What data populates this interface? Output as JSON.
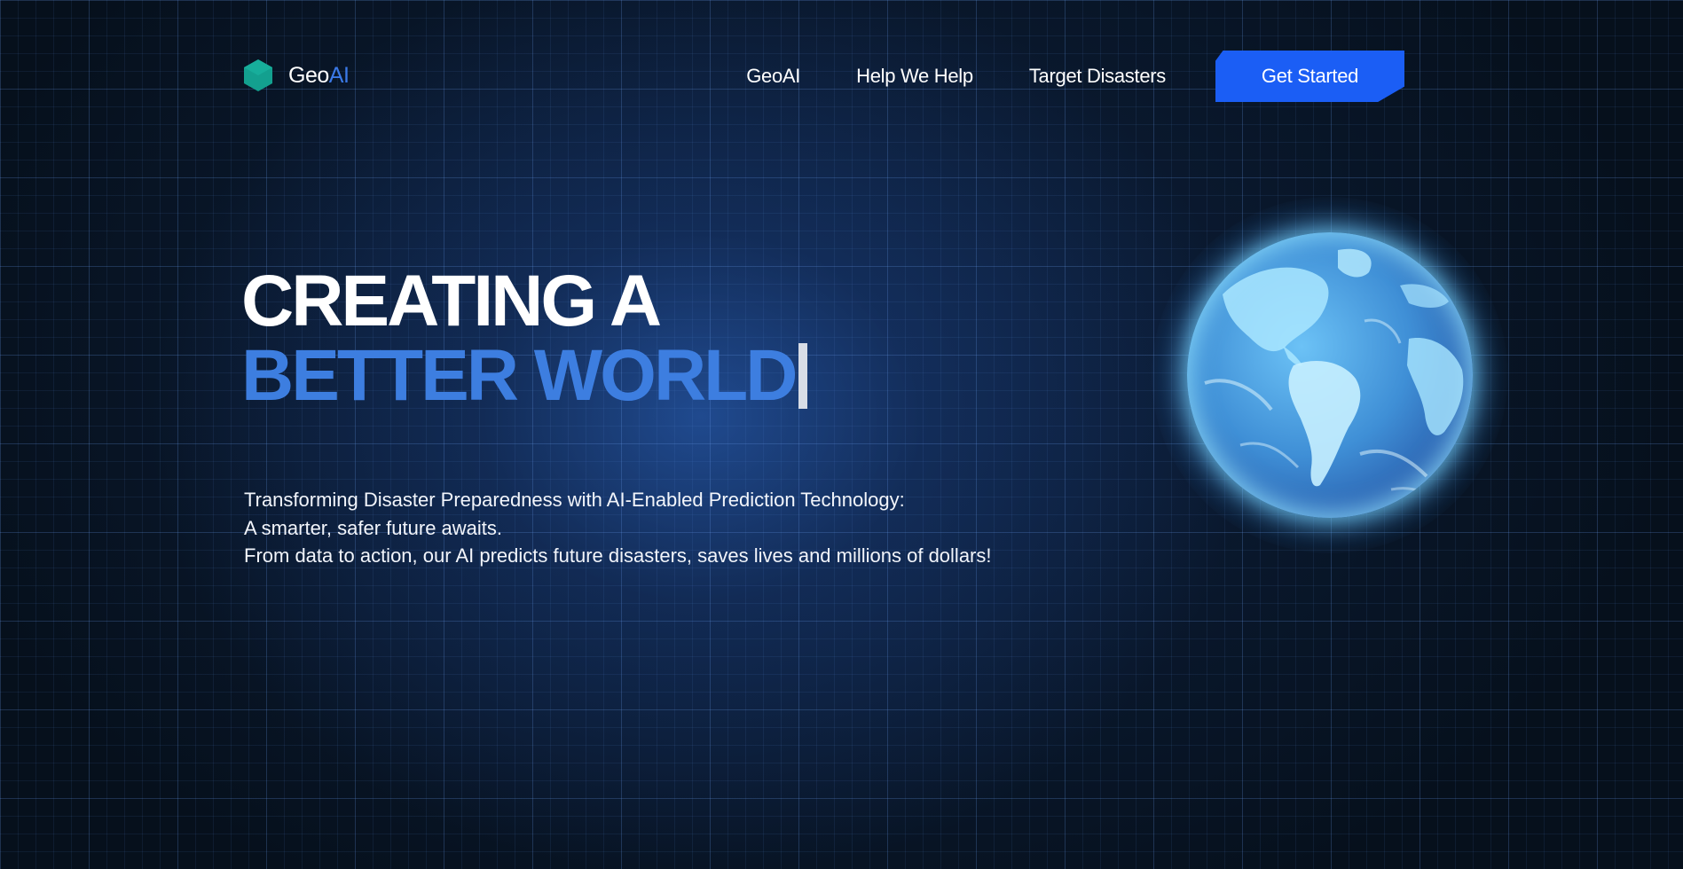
{
  "brand": {
    "name_prefix": "Geo",
    "name_accent": "AI",
    "icon": "hexagon-logo-icon",
    "icon_color": "#13a08f"
  },
  "nav": {
    "links": [
      {
        "label": "GeoAI"
      },
      {
        "label": "Help We Help"
      },
      {
        "label": "Target Disasters"
      }
    ],
    "cta_label": "Get Started",
    "cta_color": "#1b5ef5"
  },
  "hero": {
    "title_line1": "CREATING A",
    "title_line2": "BETTER WORLD",
    "accent_color": "#3d7ee0",
    "description": [
      "Transforming Disaster Preparedness with AI-Enabled Prediction Technology:",
      "A smarter, safer future awaits.",
      "From data to action, our AI predicts future disasters, saves lives and millions of dollars!"
    ]
  },
  "globe": {
    "icon": "earth-globe-icon",
    "glow_color": "#5ac8ff"
  }
}
